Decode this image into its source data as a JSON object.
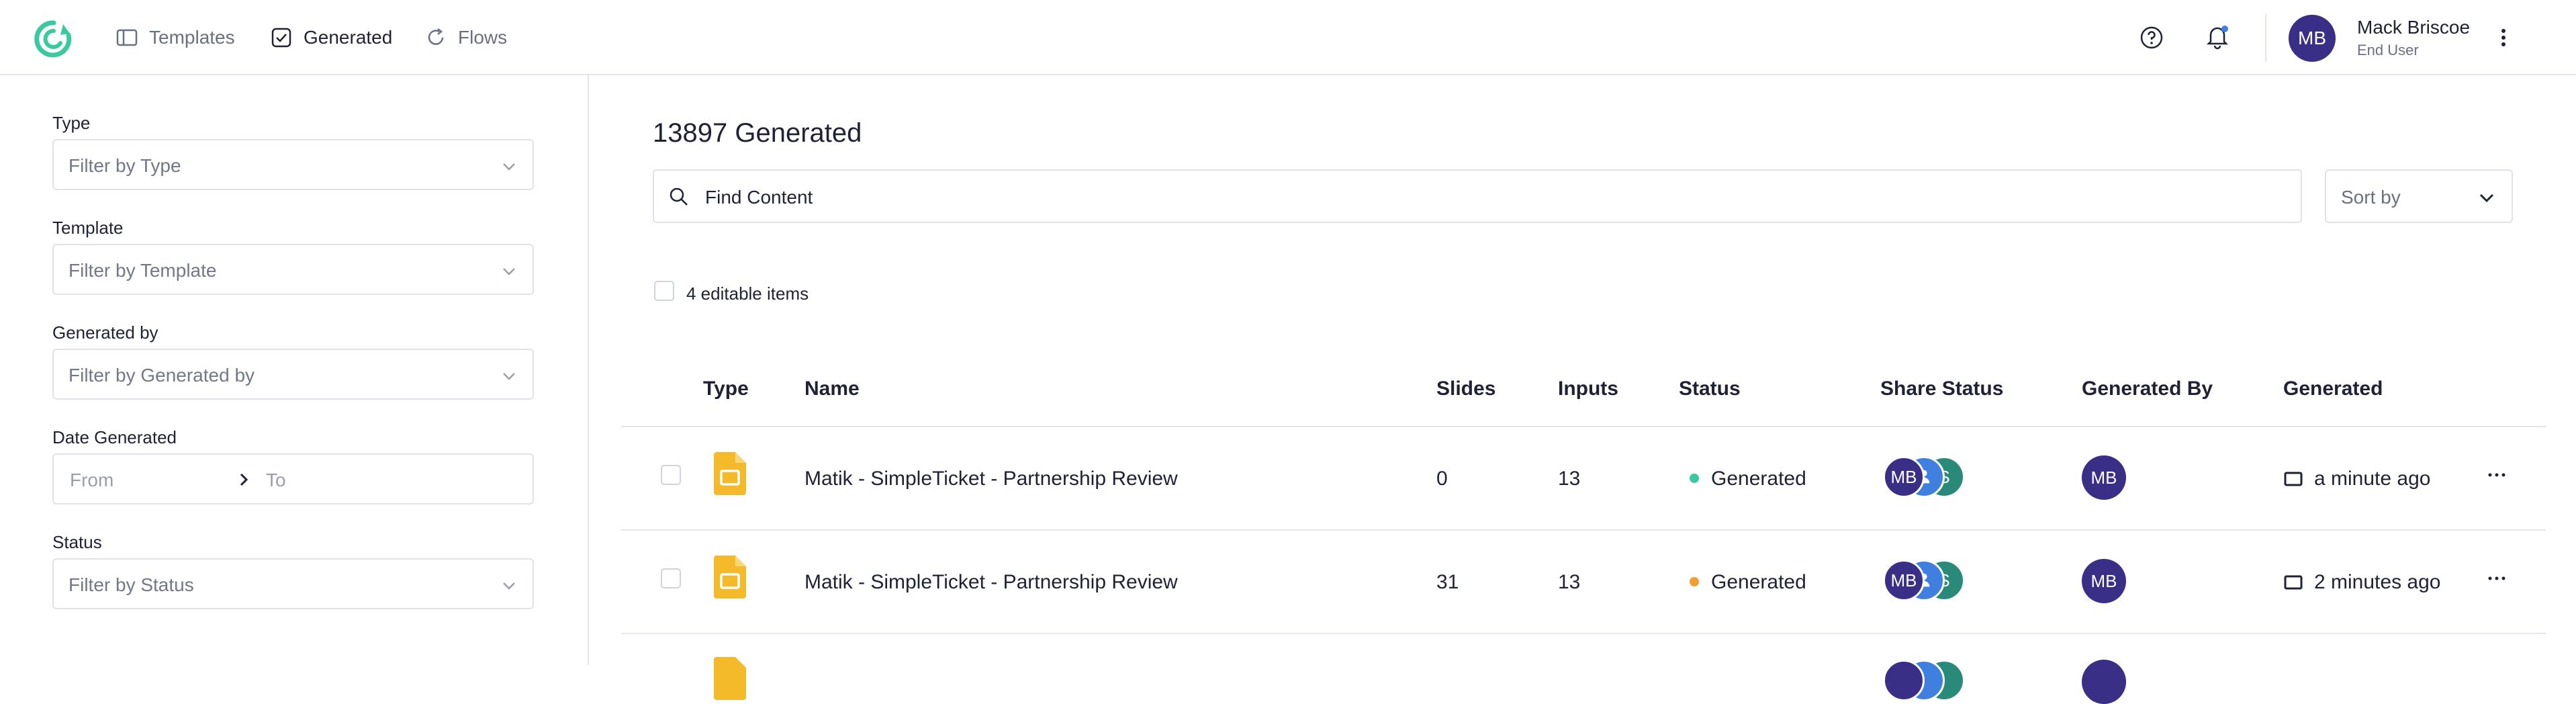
{
  "nav": {
    "items": [
      {
        "label": "Templates",
        "icon": "layout-icon",
        "active": false
      },
      {
        "label": "Generated",
        "icon": "check-square-icon",
        "active": true
      },
      {
        "label": "Flows",
        "icon": "refresh-icon",
        "active": false
      }
    ]
  },
  "user": {
    "initials": "MB",
    "name": "Mack Briscoe",
    "role": "End User"
  },
  "filters": {
    "type": {
      "label": "Type",
      "placeholder": "Filter by Type"
    },
    "template": {
      "label": "Template",
      "placeholder": "Filter by Template"
    },
    "generated_by": {
      "label": "Generated by",
      "placeholder": "Filter by Generated by"
    },
    "date": {
      "label": "Date Generated",
      "from": "From",
      "to": "To"
    },
    "status": {
      "label": "Status",
      "placeholder": "Filter by Status"
    }
  },
  "main": {
    "title": "13897 Generated",
    "search_placeholder": "Find Content",
    "sort_label": "Sort by",
    "editable_label": "4 editable items"
  },
  "table": {
    "columns": [
      "Type",
      "Name",
      "Slides",
      "Inputs",
      "Status",
      "Share Status",
      "Generated By",
      "Generated"
    ],
    "rows": [
      {
        "name": "Matik - SimpleTicket - Partnership Review",
        "slides": "0",
        "inputs": "13",
        "status": "Generated",
        "status_color": "#3cc8a0",
        "share": [
          "MB",
          "",
          "S"
        ],
        "generated_by": "MB",
        "generated": "a minute ago"
      },
      {
        "name": "Matik - SimpleTicket - Partnership Review",
        "slides": "31",
        "inputs": "13",
        "status": "Generated",
        "status_color": "#f0a030",
        "share": [
          "MB",
          "",
          "S"
        ],
        "generated_by": "MB",
        "generated": "2 minutes ago"
      }
    ]
  },
  "colors": {
    "accent": "#3cc8a0",
    "avatar": "#3a2f86",
    "share_blue": "#3f7fe0",
    "share_teal": "#2a8a7a",
    "doc_yellow": "#f5ba2a"
  }
}
